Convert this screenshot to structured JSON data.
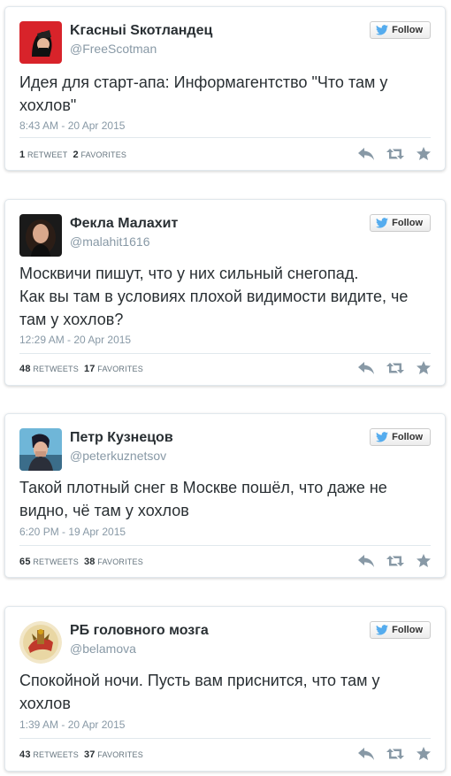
{
  "colors": {
    "bird_blue": "#55acee",
    "text_dark": "#292f33",
    "text_muted": "#8899a6",
    "icon_gray": "#8899a6"
  },
  "follow_label": "Follow",
  "tweets": [
    {
      "name": "Kгaсныi Sкотландец",
      "handle": "@FreeScotman",
      "text_lines": [
        "Идея для старт-апа: Информагентство \"Что там у",
        "хохлов\""
      ],
      "timestamp": "8:43 AM - 20 Apr 2015",
      "retweets_count": "1",
      "retweets_label": "RETWEET",
      "favorites_count": "2",
      "favorites_label": "FAVORITES"
    },
    {
      "name": "Фекла Малахит",
      "handle": "@malahit1616",
      "text_lines": [
        "Москвичи пишут, что у них сильный снегопад.",
        "Как вы там в условиях плохой видимости видите, че",
        "там у хохлов?"
      ],
      "timestamp": "12:29 AM - 20 Apr 2015",
      "retweets_count": "48",
      "retweets_label": "RETWEETS",
      "favorites_count": "17",
      "favorites_label": "FAVORITES"
    },
    {
      "name": "Петр Кузнецов",
      "handle": "@peterkuznetsov",
      "text_lines": [
        "Такой плотный снег в Москве пошёл, что даже не",
        "видно, чё там у хохлов"
      ],
      "timestamp": "6:20 PM - 19 Apr 2015",
      "retweets_count": "65",
      "retweets_label": "RETWEETS",
      "favorites_count": "38",
      "favorites_label": "FAVORITES"
    },
    {
      "name": "РБ головного мозга",
      "handle": "@belamova",
      "text_lines": [
        "Спокойной ночи. Пусть вам приснится, что там у",
        "хохлов"
      ],
      "timestamp": "1:39 AM - 20 Apr 2015",
      "retweets_count": "43",
      "retweets_label": "RETWEETS",
      "favorites_count": "37",
      "favorites_label": "FAVORITES"
    }
  ]
}
